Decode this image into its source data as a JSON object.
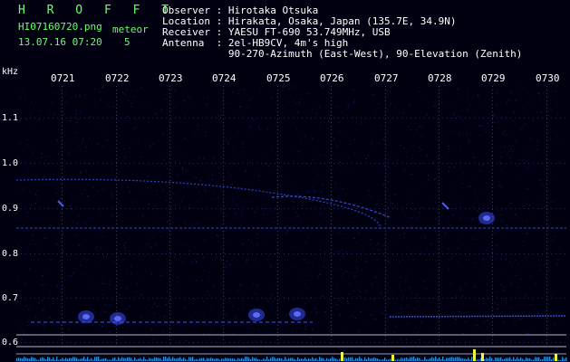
{
  "header": {
    "app_name": "H R O F F T",
    "filename": "HI07160720.png",
    "datetime": "13.07.16 07:20",
    "meteor_label": "meteor",
    "meteor_count": "5",
    "observer": "Observer : Hirotaka Otsuka",
    "location": "Location : Hirakata, Osaka, Japan (135.7E, 34.9N)",
    "receiver": "Receiver : YAESU FT-690 53.749MHz, USB",
    "antenna": "Antenna  : 2el-HB9CV, 4m's high",
    "antenna2": "           90-270-Azimuth (East-West), 90-Elevation (Zenith)"
  },
  "axis": {
    "unit": "kHz",
    "y_ticks": [
      "1.1",
      "1.0",
      "0.9",
      "0.8",
      "0.7",
      "0.6"
    ],
    "x_ticks": [
      "0721",
      "0722",
      "0723",
      "0724",
      "0725",
      "0726",
      "0727",
      "0728",
      "0729",
      "0730"
    ]
  },
  "colors": {
    "background": "#000010",
    "signal": "#3a4cff",
    "noise": "#1a2a7a",
    "histogram": "#2aa8ff",
    "histogram_peak": "#e6ff3a"
  }
}
